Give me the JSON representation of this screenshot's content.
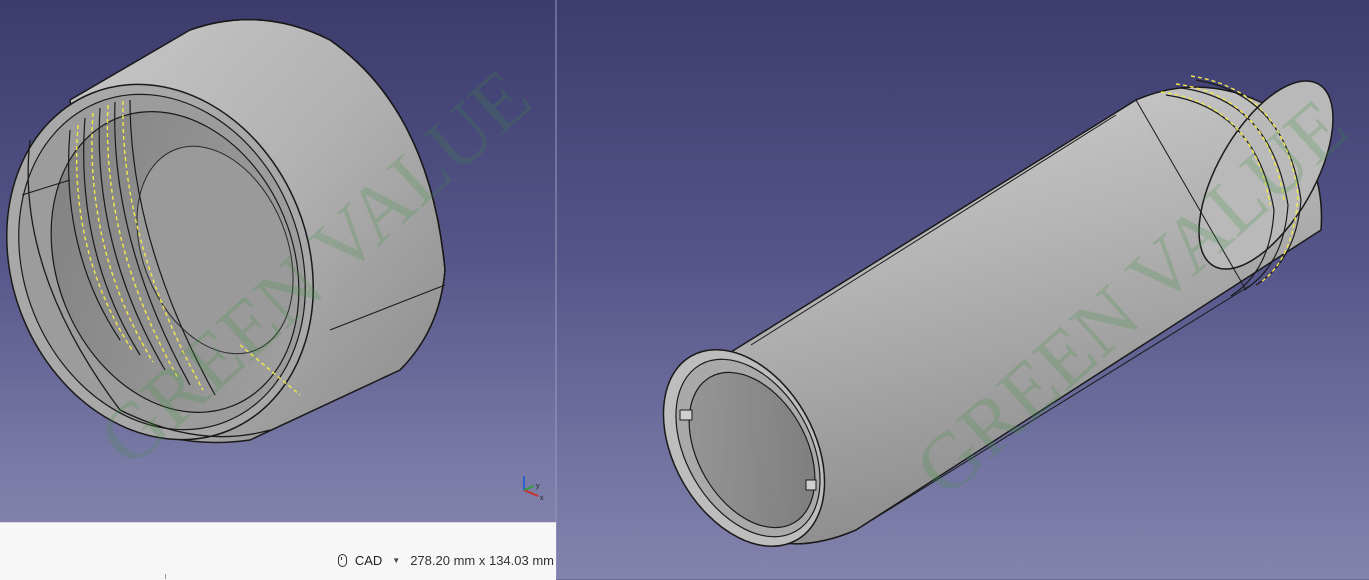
{
  "statusbar": {
    "nav_style": "CAD",
    "dimensions": "278.20 mm x 134.03 mm"
  },
  "axis": {
    "y_label": "y",
    "x_label": "x"
  },
  "watermarks": {
    "left": "GREEN VALUE",
    "right": "GREEN VALUE"
  },
  "colors": {
    "background_top": "#3c3b6c",
    "background_bottom": "#8686b0",
    "part_fill": "#b4b4b4",
    "edge": "#1a1a1a",
    "selection_highlight": "#f2e84a",
    "watermark_green": "#3e8f3e"
  },
  "icons": {
    "mouse": "mouse-icon",
    "axis_cross": "axis-cross-icon"
  }
}
